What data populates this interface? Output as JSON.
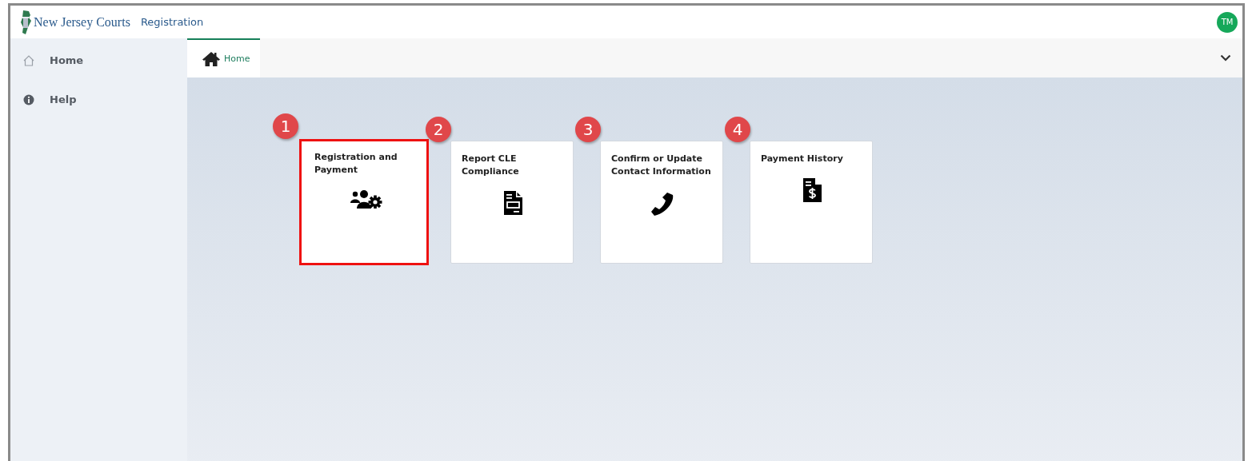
{
  "header": {
    "brand": "New Jersey Courts",
    "app_title": "Registration",
    "avatar": "TM"
  },
  "sidebar": {
    "items": [
      {
        "label": "Home",
        "kind": "home",
        "selected": false
      },
      {
        "label": "Help",
        "kind": "info",
        "selected": false
      }
    ]
  },
  "tabs": [
    {
      "label": "Home",
      "selected": true
    }
  ],
  "tiles": [
    {
      "step": "1",
      "title": "Registration and Payment",
      "kind": "users-gear",
      "highlighted": true
    },
    {
      "step": "2",
      "title": "Report CLE Compliance",
      "kind": "document",
      "highlighted": false
    },
    {
      "step": "3",
      "title": "Confirm or Update Contact Information",
      "kind": "phone",
      "highlighted": false
    },
    {
      "step": "4",
      "title": "Payment History",
      "kind": "invoice",
      "highlighted": false
    }
  ]
}
